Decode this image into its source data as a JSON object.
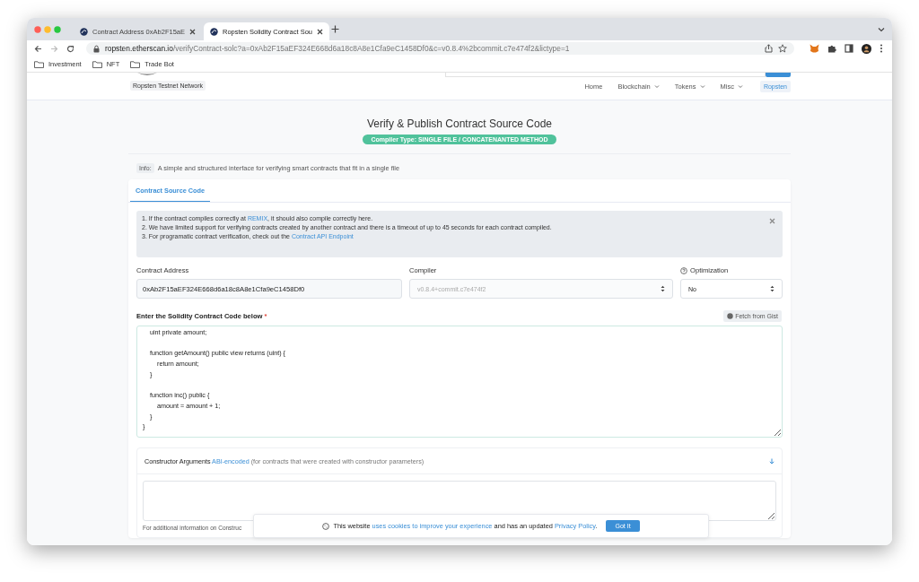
{
  "browser": {
    "tabs": [
      {
        "title": "Contract Address 0xAb2F15aE",
        "selected": false
      },
      {
        "title": "Ropsten Solidity Contract Sou",
        "selected": true
      }
    ],
    "url": {
      "host": "ropsten.etherscan.io",
      "path": "/verifyContract-solc?a=0xAb2F15aEF324E668d6a18c8A8e1Cfa9eC1458Df0&c=v0.8.4%2bcommit.c7e474f2&lictype=1"
    },
    "bookmarks": [
      "Investment",
      "NFT",
      "Trade Bot"
    ]
  },
  "header": {
    "network": "Ropsten Testnet Network",
    "nav": [
      {
        "label": "Home",
        "dropdown": false
      },
      {
        "label": "Blockchain",
        "dropdown": true
      },
      {
        "label": "Tokens",
        "dropdown": true
      },
      {
        "label": "Misc",
        "dropdown": true
      }
    ],
    "network_badge": "Ropsten"
  },
  "title": "Verify & Publish Contract Source Code",
  "compiler_type": "Compiler Type: SINGLE FILE / CONCATENANTED METHOD",
  "info": {
    "label": "Info:",
    "text": "A simple and structured interface for verifying smart contracts that fit in a single file"
  },
  "card": {
    "tabs": [
      {
        "label": "Contract Source Code",
        "selected": true
      }
    ],
    "notes": [
      [
        {
          "kind": "text",
          "text": "1. If the contract compiles correctly at "
        },
        {
          "kind": "link",
          "text": "REMIX"
        },
        {
          "kind": "text",
          "text": ", it should also compile correctly here."
        }
      ],
      [
        {
          "kind": "text",
          "text": "2. We have limited support for verifying contracts created by another contract and there is a timeout of up to 45 seconds for each contract compiled."
        }
      ],
      [
        {
          "kind": "text",
          "text": "3. For programatic contract verification, check out the "
        },
        {
          "kind": "link",
          "text": "Contract API Endpoint"
        }
      ]
    ],
    "fields": [
      {
        "kind": "input",
        "label": "Contract Address",
        "value": "0xAb2F15aEF324E668d6a18c8A8e1Cfa9eC1458Df0",
        "disabled": false,
        "help": false
      },
      {
        "kind": "select",
        "label": "Compiler",
        "value": "v0.8.4+commit.c7e474f2",
        "disabled": true,
        "help": false
      },
      {
        "kind": "select",
        "label": "Optimization",
        "value": "No",
        "disabled": false,
        "help": true
      }
    ],
    "code": {
      "label": "Enter the Solidity Contract Code below",
      "required_mark": "*",
      "fetch_button": "Fetch from Gist",
      "value": "    uint private amount;\n\n    function getAmount() public view returns (uint) {\n        return amount;\n    }\n\n    function inc() public {\n        amount = amount + 1;\n    }\n}"
    },
    "constructor": {
      "title": [
        {
          "kind": "text",
          "text": "Constructor Arguments "
        },
        {
          "kind": "link",
          "text": "ABI-encoded"
        },
        {
          "kind": "muted",
          "text": " (for contracts that were created with constructor parameters)"
        }
      ],
      "hint": "For additional information on Construc"
    }
  },
  "cookie": {
    "parts": [
      {
        "kind": "text",
        "text": "This website "
      },
      {
        "kind": "link",
        "text": "uses cookies to improve your experience"
      },
      {
        "kind": "text",
        "text": " and has an updated "
      },
      {
        "kind": "link",
        "text": "Privacy Policy"
      },
      {
        "kind": "text",
        "text": "."
      }
    ],
    "button": "Got It"
  }
}
